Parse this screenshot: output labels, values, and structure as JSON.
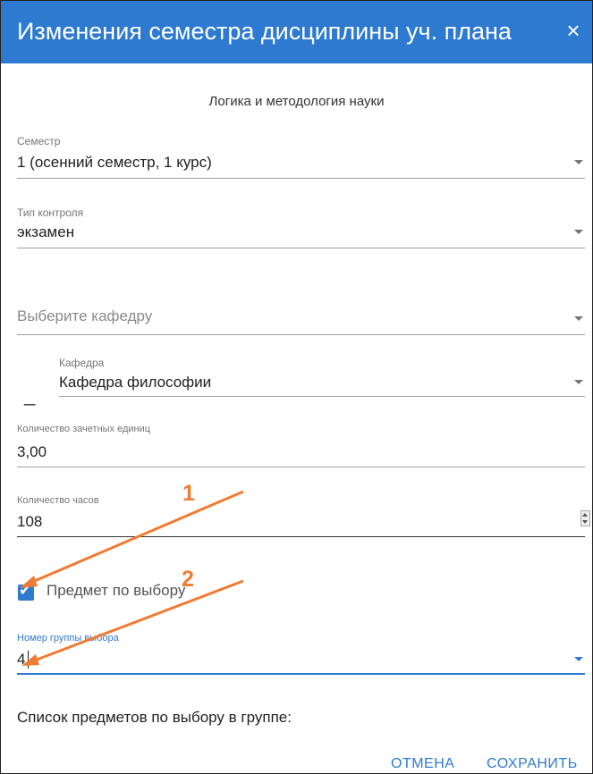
{
  "dialog": {
    "title": "Изменения семестра дисциплины уч. плана",
    "close_icon": "×",
    "subject": "Логика и методология науки"
  },
  "fields": {
    "semester": {
      "label": "Семестр",
      "value": "1 (осенний семестр, 1 курс)"
    },
    "control_type": {
      "label": "Тип контроля",
      "value": "экзамен"
    },
    "choose_department": {
      "placeholder": "Выберите кафедру"
    },
    "department": {
      "label": "Кафедра",
      "value": "Кафедра философии",
      "remove_icon": "_"
    },
    "credits": {
      "label": "Количество зачетных единиц",
      "value": "3,00"
    },
    "hours": {
      "label": "Количество часов",
      "value": "108"
    },
    "elective": {
      "label": "Предмет по выбору",
      "checked": true,
      "check_icon": "✔"
    },
    "group_number": {
      "label": "Номер группы выбора",
      "value": "4"
    }
  },
  "list_title": "Список предметов по выбору в группе:",
  "buttons": {
    "cancel": "ОТМЕНА",
    "save": "СОХРАНИТЬ"
  },
  "annotations": {
    "one": "1",
    "two": "2"
  },
  "colors": {
    "accent": "#2d7ad0",
    "annotation": "#f07b32"
  }
}
